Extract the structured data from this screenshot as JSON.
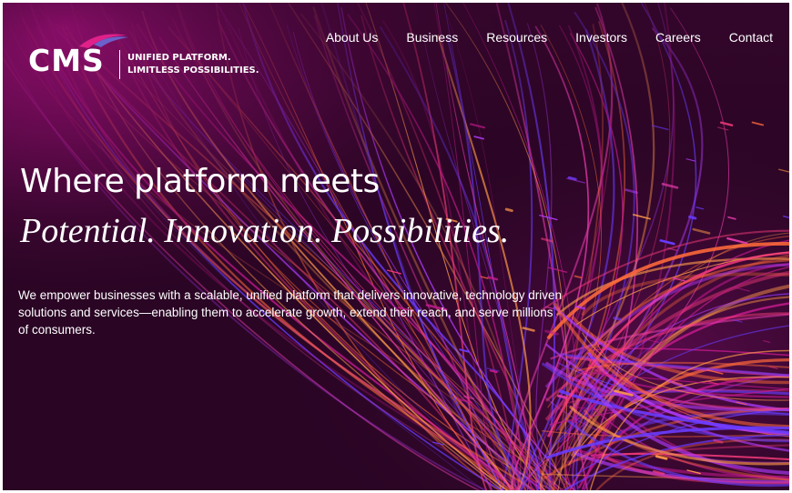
{
  "brand": {
    "logo_text": "CMS",
    "tagline_line1": "UNIFIED PLATFORM.",
    "tagline_line2": "LIMITLESS POSSIBILITIES."
  },
  "nav": {
    "items": [
      {
        "label": "About Us"
      },
      {
        "label": "Business"
      },
      {
        "label": "Resources"
      },
      {
        "label": "Investors"
      },
      {
        "label": "Careers"
      },
      {
        "label": "Contact"
      }
    ]
  },
  "hero": {
    "title": "Where platform meets",
    "subtitle": "Potential. Innovation. Possibilities.",
    "body": "We empower businesses with a scalable, unified platform that delivers innovative, technology driven solutions and services—enabling them to accelerate growth, extend their reach, and serve millions of consumers."
  },
  "colors": {
    "background": "#2a0524",
    "accent_magenta": "#c21a8c",
    "accent_orange": "#ff6a3a",
    "accent_violet": "#6a3cff",
    "text": "#ffffff"
  }
}
